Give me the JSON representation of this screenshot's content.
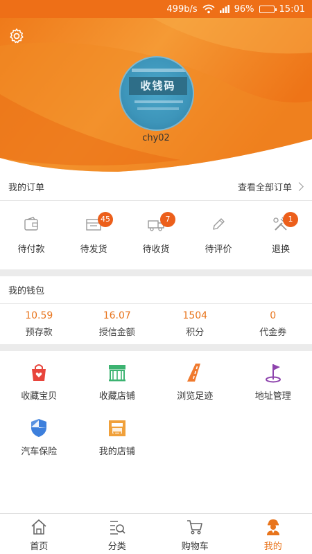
{
  "status_bar": {
    "speed": "499b/s",
    "battery": "96%",
    "battery_level": 0.96,
    "time": "15:01"
  },
  "header": {
    "avatar_text": "收钱码",
    "username": "chy02",
    "colors": {
      "primary": "#ee6f17",
      "light": "#f6a03a"
    }
  },
  "orders": {
    "title": "我的订单",
    "view_all": "查看全部订单",
    "items": [
      {
        "label": "待付款",
        "icon": "wallet-icon",
        "badge": null
      },
      {
        "label": "待发货",
        "icon": "package-icon",
        "badge": "45"
      },
      {
        "label": "待收货",
        "icon": "truck-icon",
        "badge": "7"
      },
      {
        "label": "待评价",
        "icon": "pencil-icon",
        "badge": null
      },
      {
        "label": "退换",
        "icon": "tools-icon",
        "badge": "1"
      }
    ]
  },
  "wallet": {
    "title": "我的钱包",
    "items": [
      {
        "value": "10.59",
        "label": "预存款"
      },
      {
        "value": "16.07",
        "label": "授信金额"
      },
      {
        "value": "1504",
        "label": "积分"
      },
      {
        "value": "0",
        "label": "代金券"
      }
    ]
  },
  "services": [
    {
      "label": "收藏宝贝",
      "icon": "favorite-bag-icon",
      "color": "#e8453c"
    },
    {
      "label": "收藏店铺",
      "icon": "store-icon",
      "color": "#3cb371"
    },
    {
      "label": "浏览足迹",
      "icon": "road-icon",
      "color": "#f07a2e"
    },
    {
      "label": "地址管理",
      "icon": "flag-icon",
      "color": "#8e44ad"
    },
    {
      "label": "汽车保险",
      "icon": "shield-icon",
      "color": "#3d7fdc"
    },
    {
      "label": "我的店铺",
      "icon": "shop-icon",
      "color": "#f0a03a"
    }
  ],
  "tabbar": {
    "items": [
      {
        "label": "首页",
        "icon": "home-icon",
        "active": false
      },
      {
        "label": "分类",
        "icon": "category-icon",
        "active": false
      },
      {
        "label": "购物车",
        "icon": "cart-icon",
        "active": false
      },
      {
        "label": "我的",
        "icon": "user-icon",
        "active": true
      }
    ],
    "active_color": "#e8741c"
  }
}
